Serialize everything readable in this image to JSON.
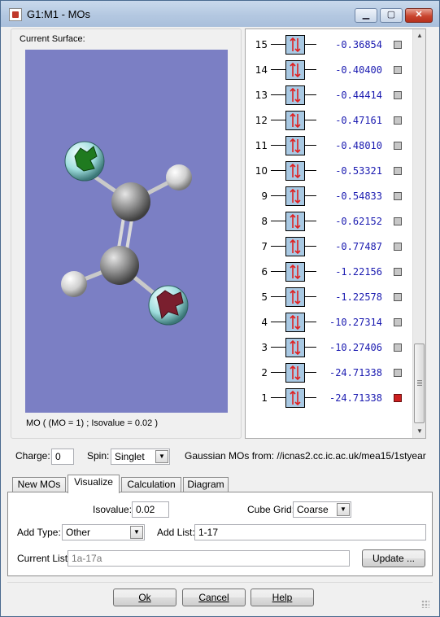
{
  "window": {
    "title": "G1:M1 - MOs"
  },
  "surface": {
    "label": "Current Surface:",
    "caption": "MO ( (MO = 1) ; Isovalue = 0.02 )"
  },
  "mo_list": {
    "rows": [
      {
        "num": "15",
        "energy": "-0.36854",
        "selected": false
      },
      {
        "num": "14",
        "energy": "-0.40400",
        "selected": false
      },
      {
        "num": "13",
        "energy": "-0.44414",
        "selected": false
      },
      {
        "num": "12",
        "energy": "-0.47161",
        "selected": false
      },
      {
        "num": "11",
        "energy": "-0.48010",
        "selected": false
      },
      {
        "num": "10",
        "energy": "-0.53321",
        "selected": false
      },
      {
        "num": "9",
        "energy": "-0.54833",
        "selected": false
      },
      {
        "num": "8",
        "energy": "-0.62152",
        "selected": false
      },
      {
        "num": "7",
        "energy": "-0.77487",
        "selected": false
      },
      {
        "num": "6",
        "energy": "-1.22156",
        "selected": false
      },
      {
        "num": "5",
        "energy": "-1.22578",
        "selected": false
      },
      {
        "num": "4",
        "energy": "-10.27314",
        "selected": false
      },
      {
        "num": "3",
        "energy": "-10.27406",
        "selected": false
      },
      {
        "num": "2",
        "energy": "-24.71338",
        "selected": false
      },
      {
        "num": "1",
        "energy": "-24.71338",
        "selected": true
      }
    ],
    "occupancy_symbol": "↑↓"
  },
  "params": {
    "charge_label": "Charge:",
    "charge_value": "0",
    "spin_label": "Spin:",
    "spin_value": "Singlet",
    "source_text": "Gaussian MOs from:  //icnas2.cc.ic.ac.uk/mea15/1styear"
  },
  "tabs": [
    {
      "label": "New MOs",
      "active": false
    },
    {
      "label": "Visualize",
      "active": true
    },
    {
      "label": "Calculation",
      "active": false
    },
    {
      "label": "Diagram",
      "active": false
    }
  ],
  "visualize": {
    "isovalue_label": "Isovalue:",
    "isovalue_value": "0.02",
    "cube_grid_label": "Cube Grid:",
    "cube_grid_value": "Coarse",
    "add_type_label": "Add Type:",
    "add_type_value": "Other",
    "add_list_label": "Add List:",
    "add_list_value": "1-17",
    "current_list_label": "Current List:",
    "current_list_value": "1a-17a",
    "update_label": "Update ..."
  },
  "footer": {
    "ok": "Ok",
    "cancel": "Cancel",
    "help": "Help"
  },
  "colors": {
    "selected_flag": "#cc1f1f",
    "energy_text": "#1a1ab0",
    "viewport_bg": "#7b7fc4"
  }
}
